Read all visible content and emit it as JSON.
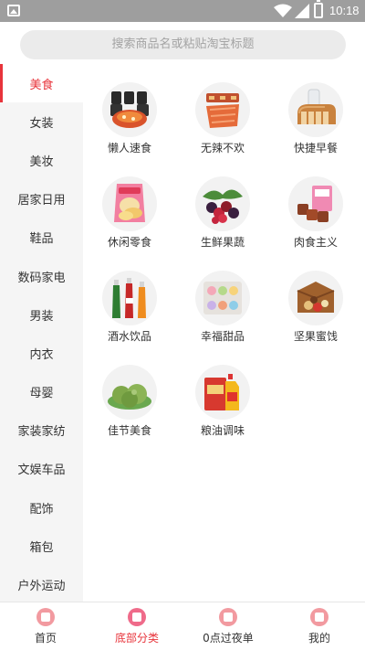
{
  "status_bar": {
    "time": "10:18"
  },
  "search": {
    "placeholder": "搜索商品名或粘贴淘宝标题"
  },
  "sidebar": {
    "items": [
      {
        "label": "美食",
        "active": true
      },
      {
        "label": "女装"
      },
      {
        "label": "美妆"
      },
      {
        "label": "居家日用"
      },
      {
        "label": "鞋品"
      },
      {
        "label": "数码家电"
      },
      {
        "label": "男装"
      },
      {
        "label": "内衣"
      },
      {
        "label": "母婴"
      },
      {
        "label": "家装家纺"
      },
      {
        "label": "文娱车品"
      },
      {
        "label": "配饰"
      },
      {
        "label": "箱包"
      },
      {
        "label": "户外运动"
      }
    ]
  },
  "categories": [
    {
      "label": "懒人速食",
      "icon": "noodle-cups-icon"
    },
    {
      "label": "无辣不欢",
      "icon": "spicy-meat-icon"
    },
    {
      "label": "快捷早餐",
      "icon": "bread-milk-icon"
    },
    {
      "label": "休闲零食",
      "icon": "chips-bag-icon"
    },
    {
      "label": "生鲜果蔬",
      "icon": "berries-icon"
    },
    {
      "label": "肉食主义",
      "icon": "meat-box-icon"
    },
    {
      "label": "酒水饮品",
      "icon": "drink-bottles-icon"
    },
    {
      "label": "幸福甜品",
      "icon": "macaron-box-icon"
    },
    {
      "label": "坚果蜜饯",
      "icon": "nuts-box-icon"
    },
    {
      "label": "佳节美食",
      "icon": "rice-cakes-icon"
    },
    {
      "label": "粮油调味",
      "icon": "rice-oil-icon"
    }
  ],
  "bottom_nav": {
    "items": [
      {
        "label": "首页",
        "icon": "home-icon"
      },
      {
        "label": "底部分类",
        "icon": "category-icon",
        "active": true
      },
      {
        "label": "0点过夜单",
        "icon": "bell-icon"
      },
      {
        "label": "我的",
        "icon": "profile-icon"
      }
    ]
  },
  "colors": {
    "accent": "#e8343b",
    "sidebar_bg": "#f5f5f5",
    "search_bg": "#ebebeb",
    "status_bar": "#9e9e9e"
  }
}
